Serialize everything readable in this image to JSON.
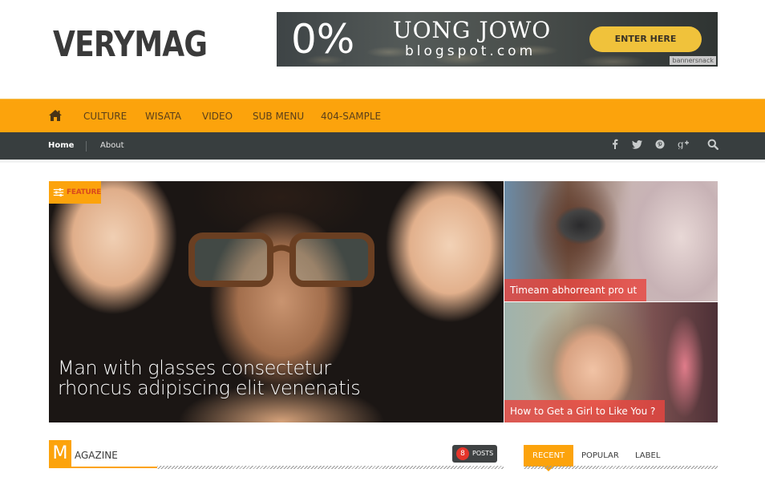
{
  "header": {
    "logo": "VERYMAG",
    "ad": {
      "headline": "0%",
      "title": "UONG JOWO",
      "subtitle": "blogspot.com",
      "cta": "ENTER HERE",
      "brand": "bannersnack",
      "cta_color": "#f0c23b"
    }
  },
  "main_nav": {
    "home_icon": "home-icon",
    "items": [
      {
        "label": "CULTURE"
      },
      {
        "label": "WISATA"
      },
      {
        "label": "VIDEO"
      },
      {
        "label": "SUB MENU"
      },
      {
        "label": "404-SAMPLE"
      }
    ],
    "bg_color": "#fca30c"
  },
  "sub_nav": {
    "items": [
      {
        "label": "Home",
        "active": true
      },
      {
        "label": "About",
        "active": false
      }
    ],
    "social": [
      {
        "icon": "facebook-icon",
        "glyph": "f"
      },
      {
        "icon": "twitter-icon",
        "glyph": "🐦"
      },
      {
        "icon": "pinterest-icon",
        "glyph": "℗"
      },
      {
        "icon": "google-plus-icon",
        "glyph": "g+"
      },
      {
        "icon": "search-icon",
        "glyph": "🔍"
      }
    ],
    "bg_color": "#383e3f"
  },
  "featured": {
    "badge": "FEATURE",
    "main_title": "Man with glasses consectetur rhoncus adipiscing elit venenatis",
    "side": [
      {
        "title": "Timeam abhorreant pro ut"
      },
      {
        "title": "How to Get a Girl to Like You ?"
      }
    ]
  },
  "magazine": {
    "initial": "M",
    "rest": "AGAZINE",
    "posts_count": "8",
    "posts_label": "POSTS"
  },
  "sidebar_tabs": [
    {
      "label": "RECENT",
      "active": true
    },
    {
      "label": "POPULAR",
      "active": false
    },
    {
      "label": "LABEL",
      "active": false
    }
  ]
}
